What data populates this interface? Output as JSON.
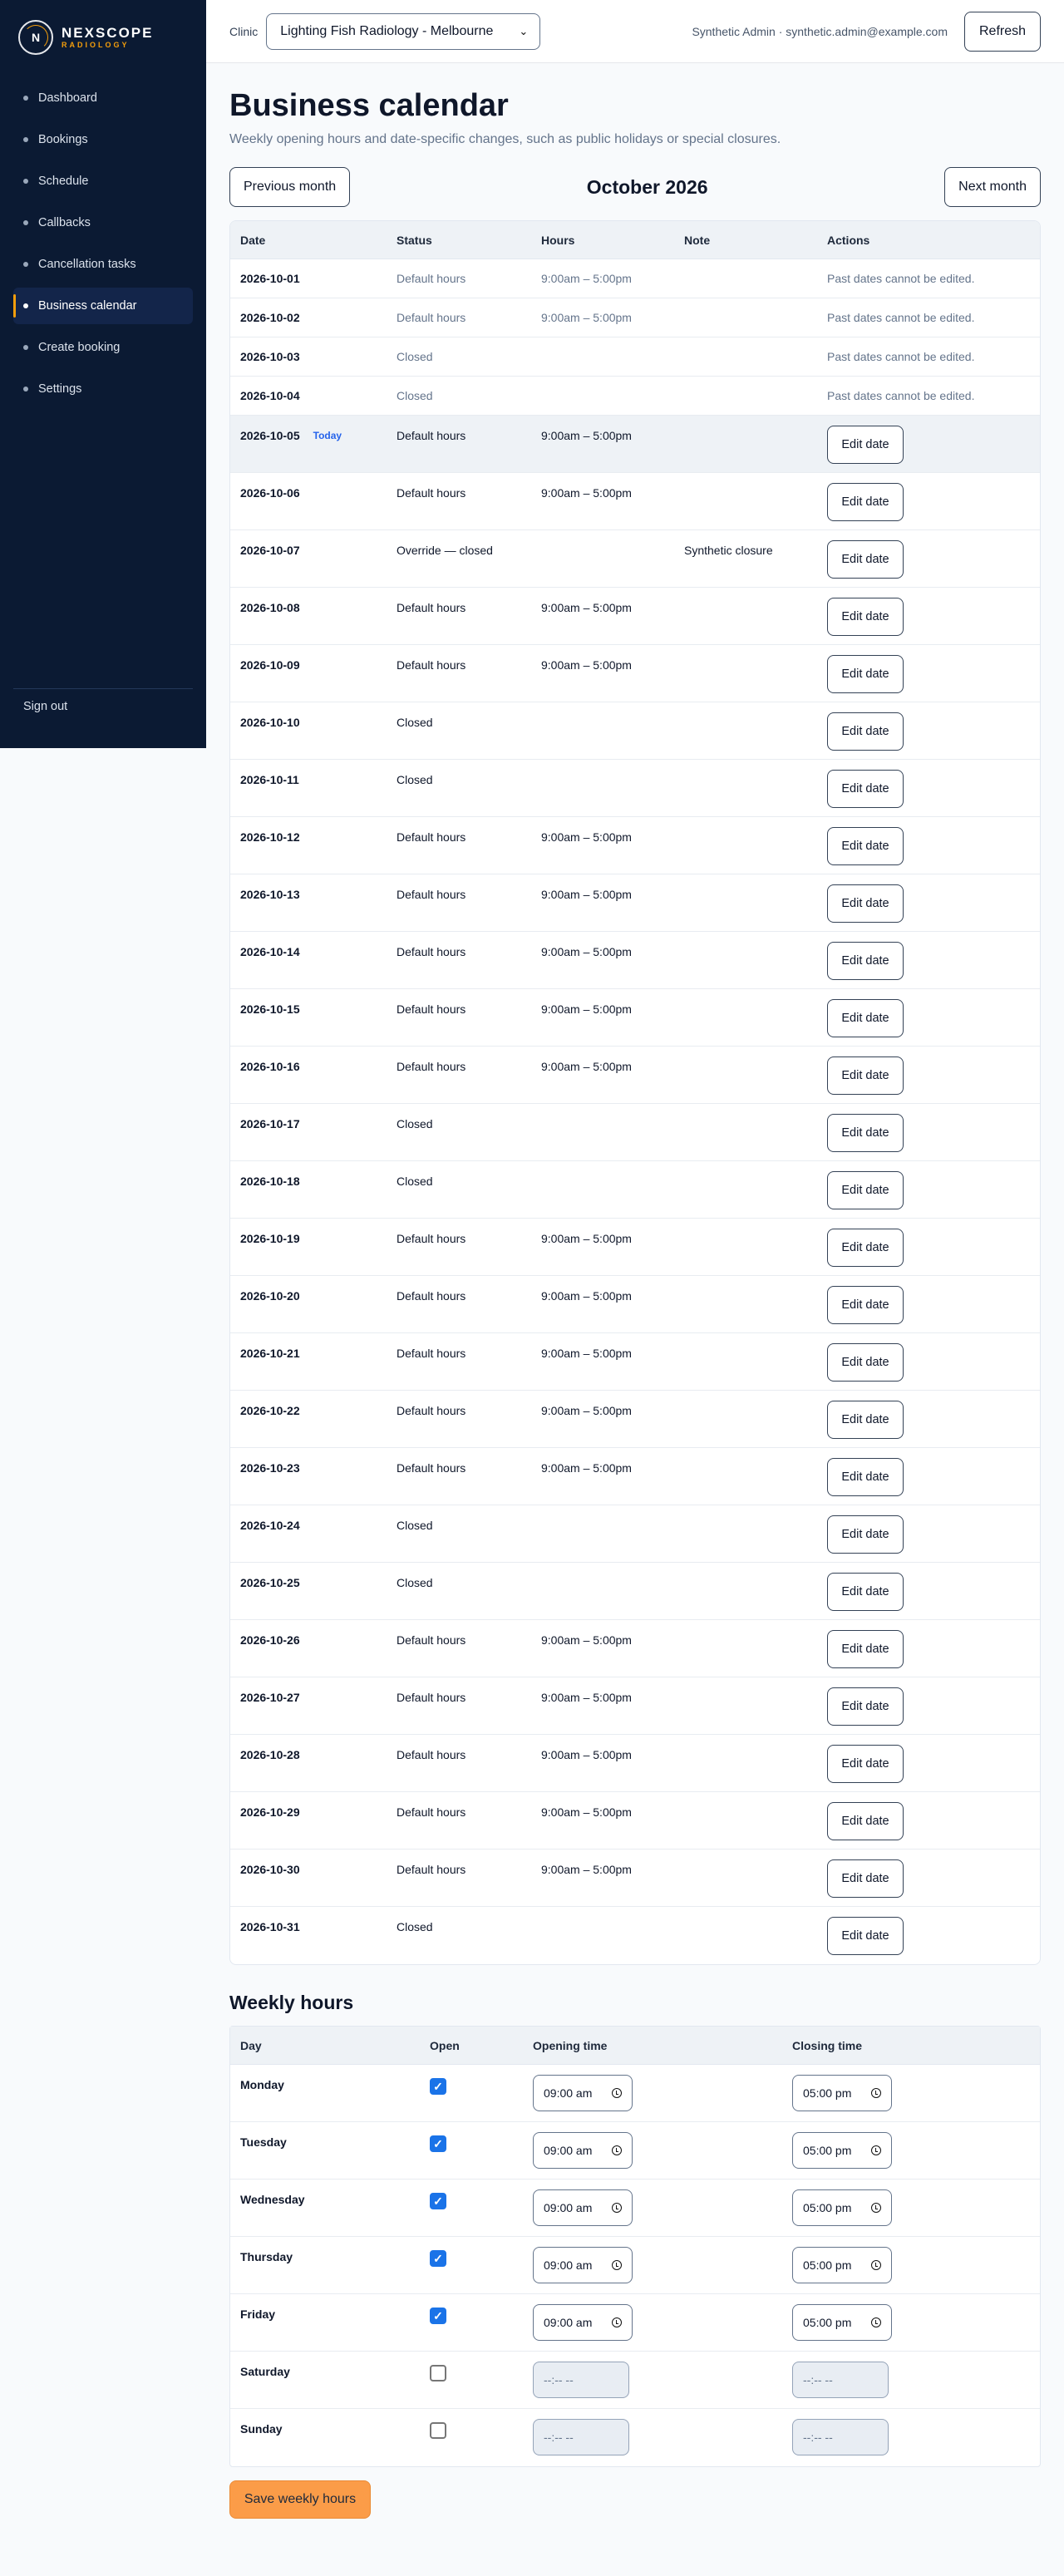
{
  "brand": {
    "name": "NEXSCOPE",
    "sub": "RADIOLOGY",
    "mark": "N"
  },
  "sidebar": {
    "items": [
      {
        "label": "Dashboard"
      },
      {
        "label": "Bookings"
      },
      {
        "label": "Schedule"
      },
      {
        "label": "Callbacks"
      },
      {
        "label": "Cancellation tasks"
      },
      {
        "label": "Business calendar",
        "active": true
      },
      {
        "label": "Create booking"
      },
      {
        "label": "Settings"
      }
    ],
    "signout": "Sign out"
  },
  "topbar": {
    "clinic_label": "Clinic",
    "clinic_value": "Lighting Fish Radiology - Melbourne",
    "user": "Synthetic Admin · synthetic.admin@example.com",
    "refresh": "Refresh"
  },
  "page": {
    "title": "Business calendar",
    "subtitle": "Weekly opening hours and date-specific changes, such as public holidays or special closures.",
    "prev": "Previous month",
    "next": "Next month",
    "month": "October 2026"
  },
  "calendar": {
    "headers": [
      "Date",
      "Status",
      "Hours",
      "Note",
      "Actions"
    ],
    "today_label": "Today",
    "edit_label": "Edit date",
    "past_note": "Past dates cannot be edited.",
    "rows": [
      {
        "date": "2026-10-01",
        "status": "Default hours",
        "hours": "9:00am – 5:00pm",
        "note": "",
        "past": true
      },
      {
        "date": "2026-10-02",
        "status": "Default hours",
        "hours": "9:00am – 5:00pm",
        "note": "",
        "past": true
      },
      {
        "date": "2026-10-03",
        "status": "Closed",
        "hours": "",
        "note": "",
        "past": true
      },
      {
        "date": "2026-10-04",
        "status": "Closed",
        "hours": "",
        "note": "",
        "past": true
      },
      {
        "date": "2026-10-05",
        "status": "Default hours",
        "hours": "9:00am – 5:00pm",
        "note": "",
        "today": true
      },
      {
        "date": "2026-10-06",
        "status": "Default hours",
        "hours": "9:00am – 5:00pm",
        "note": ""
      },
      {
        "date": "2026-10-07",
        "status": "Override — closed",
        "hours": "",
        "note": "Synthetic closure"
      },
      {
        "date": "2026-10-08",
        "status": "Default hours",
        "hours": "9:00am – 5:00pm",
        "note": ""
      },
      {
        "date": "2026-10-09",
        "status": "Default hours",
        "hours": "9:00am – 5:00pm",
        "note": ""
      },
      {
        "date": "2026-10-10",
        "status": "Closed",
        "hours": "",
        "note": ""
      },
      {
        "date": "2026-10-11",
        "status": "Closed",
        "hours": "",
        "note": ""
      },
      {
        "date": "2026-10-12",
        "status": "Default hours",
        "hours": "9:00am – 5:00pm",
        "note": ""
      },
      {
        "date": "2026-10-13",
        "status": "Default hours",
        "hours": "9:00am – 5:00pm",
        "note": ""
      },
      {
        "date": "2026-10-14",
        "status": "Default hours",
        "hours": "9:00am – 5:00pm",
        "note": ""
      },
      {
        "date": "2026-10-15",
        "status": "Default hours",
        "hours": "9:00am – 5:00pm",
        "note": ""
      },
      {
        "date": "2026-10-16",
        "status": "Default hours",
        "hours": "9:00am – 5:00pm",
        "note": ""
      },
      {
        "date": "2026-10-17",
        "status": "Closed",
        "hours": "",
        "note": ""
      },
      {
        "date": "2026-10-18",
        "status": "Closed",
        "hours": "",
        "note": ""
      },
      {
        "date": "2026-10-19",
        "status": "Default hours",
        "hours": "9:00am – 5:00pm",
        "note": ""
      },
      {
        "date": "2026-10-20",
        "status": "Default hours",
        "hours": "9:00am – 5:00pm",
        "note": ""
      },
      {
        "date": "2026-10-21",
        "status": "Default hours",
        "hours": "9:00am – 5:00pm",
        "note": ""
      },
      {
        "date": "2026-10-22",
        "status": "Default hours",
        "hours": "9:00am – 5:00pm",
        "note": ""
      },
      {
        "date": "2026-10-23",
        "status": "Default hours",
        "hours": "9:00am – 5:00pm",
        "note": ""
      },
      {
        "date": "2026-10-24",
        "status": "Closed",
        "hours": "",
        "note": ""
      },
      {
        "date": "2026-10-25",
        "status": "Closed",
        "hours": "",
        "note": ""
      },
      {
        "date": "2026-10-26",
        "status": "Default hours",
        "hours": "9:00am – 5:00pm",
        "note": ""
      },
      {
        "date": "2026-10-27",
        "status": "Default hours",
        "hours": "9:00am – 5:00pm",
        "note": ""
      },
      {
        "date": "2026-10-28",
        "status": "Default hours",
        "hours": "9:00am – 5:00pm",
        "note": ""
      },
      {
        "date": "2026-10-29",
        "status": "Default hours",
        "hours": "9:00am – 5:00pm",
        "note": ""
      },
      {
        "date": "2026-10-30",
        "status": "Default hours",
        "hours": "9:00am – 5:00pm",
        "note": ""
      },
      {
        "date": "2026-10-31",
        "status": "Closed",
        "hours": "",
        "note": ""
      }
    ]
  },
  "weekly": {
    "title": "Weekly hours",
    "headers": [
      "Day",
      "Open",
      "Opening time",
      "Closing time"
    ],
    "rows": [
      {
        "day": "Monday",
        "open": true,
        "opening": "09:00 am",
        "closing": "05:00 pm"
      },
      {
        "day": "Tuesday",
        "open": true,
        "opening": "09:00 am",
        "closing": "05:00 pm"
      },
      {
        "day": "Wednesday",
        "open": true,
        "opening": "09:00 am",
        "closing": "05:00 pm"
      },
      {
        "day": "Thursday",
        "open": true,
        "opening": "09:00 am",
        "closing": "05:00 pm"
      },
      {
        "day": "Friday",
        "open": true,
        "opening": "09:00 am",
        "closing": "05:00 pm"
      },
      {
        "day": "Saturday",
        "open": false,
        "opening": "--:-- --",
        "closing": "--:-- --"
      },
      {
        "day": "Sunday",
        "open": false,
        "opening": "--:-- --",
        "closing": "--:-- --"
      }
    ],
    "save": "Save weekly hours"
  }
}
